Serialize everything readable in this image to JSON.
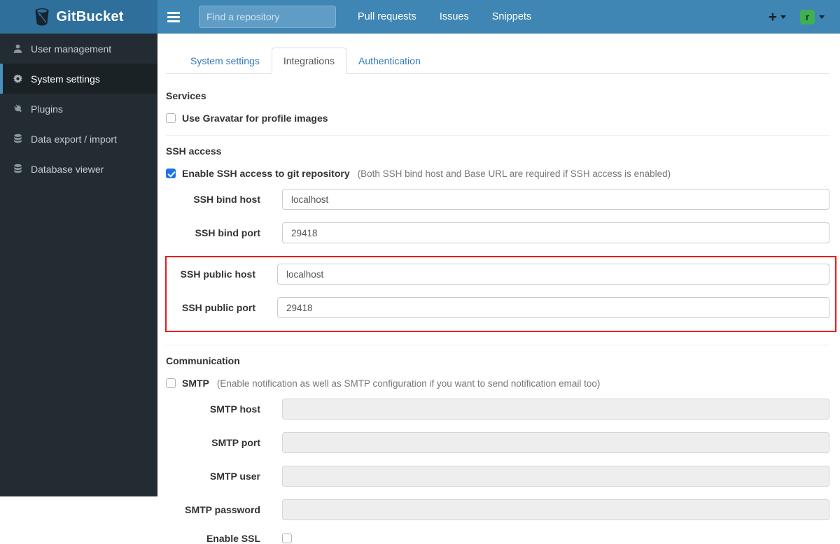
{
  "navbar": {
    "brand": "GitBucket",
    "search_placeholder": "Find a repository",
    "links": [
      "Pull requests",
      "Issues",
      "Snippets"
    ],
    "plus_label": "+",
    "avatar_letter": "r"
  },
  "sidebar": {
    "items": [
      {
        "label": "User management",
        "icon": "user-icon",
        "active": false
      },
      {
        "label": "System settings",
        "icon": "gear-icon",
        "active": true
      },
      {
        "label": "Plugins",
        "icon": "plug-icon",
        "active": false
      },
      {
        "label": "Data export / import",
        "icon": "database-icon",
        "active": false
      },
      {
        "label": "Database viewer",
        "icon": "database-icon",
        "active": false
      }
    ]
  },
  "tabs": [
    {
      "label": "System settings",
      "active": false
    },
    {
      "label": "Integrations",
      "active": true
    },
    {
      "label": "Authentication",
      "active": false
    }
  ],
  "sections": {
    "services": {
      "heading": "Services",
      "gravatar_label": "Use Gravatar for profile images",
      "gravatar_checked": false
    },
    "ssh": {
      "heading": "SSH access",
      "enable_label": "Enable SSH access to git repository",
      "enable_note": "(Both SSH bind host and Base URL are required if SSH access is enabled)",
      "enable_checked": true,
      "fields": [
        {
          "label": "SSH bind host",
          "value": "localhost"
        },
        {
          "label": "SSH bind port",
          "value": "29418"
        },
        {
          "label": "SSH public host",
          "value": "localhost"
        },
        {
          "label": "SSH public port",
          "value": "29418"
        }
      ]
    },
    "communication": {
      "heading": "Communication",
      "smtp_label": "SMTP",
      "smtp_note": "(Enable notification as well as SMTP configuration if you want to send notification email too)",
      "smtp_checked": false,
      "fields": [
        {
          "label": "SMTP host",
          "value": ""
        },
        {
          "label": "SMTP port",
          "value": ""
        },
        {
          "label": "SMTP user",
          "value": ""
        },
        {
          "label": "SMTP password",
          "value": ""
        }
      ],
      "ssl_label": "Enable SSL",
      "ssl_checked": false
    }
  },
  "colors": {
    "navbar": "#3f86b4",
    "navbar_brand": "#2f6f9b",
    "sidebar": "#232c32",
    "sidebar_active_accent": "#4890c0",
    "avatar_green": "#3fb052",
    "highlight_red": "#f01616",
    "checkbox_checked_blue": "#1b73e8",
    "tab_link_blue": "#337ab7"
  }
}
